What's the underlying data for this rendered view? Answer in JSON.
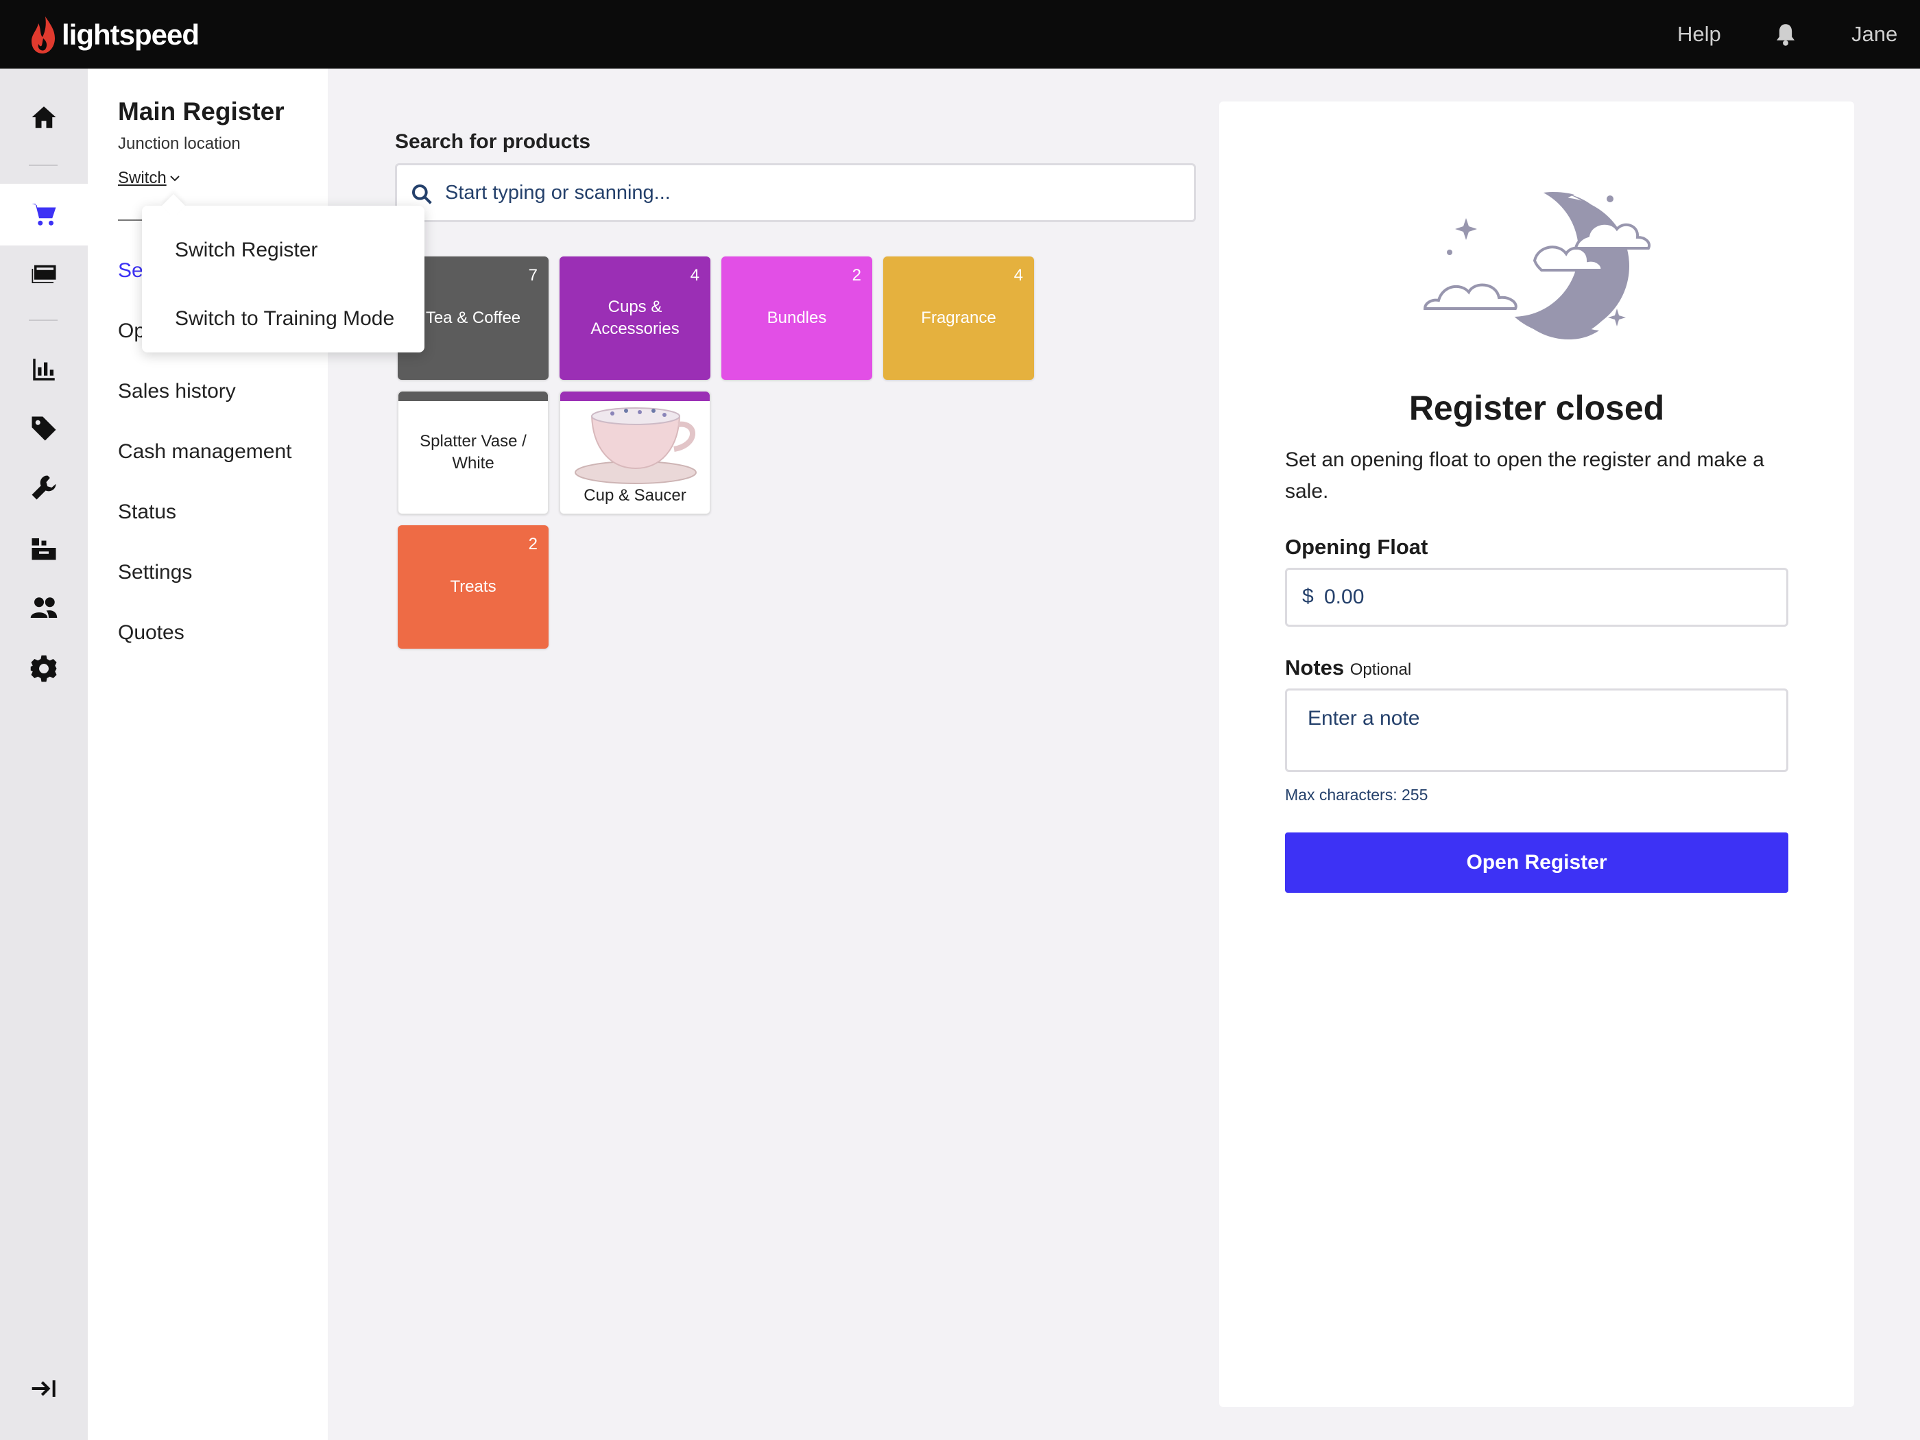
{
  "topbar": {
    "brand": "lightspeed",
    "help_label": "Help",
    "user_name": "Jane",
    "notification_icon": "bell-icon"
  },
  "rail": {
    "items": [
      {
        "icon": "home-icon"
      },
      {
        "icon": "cart-icon",
        "active": true
      },
      {
        "icon": "register-icon"
      },
      {
        "icon": "reports-icon"
      },
      {
        "icon": "tag-icon"
      },
      {
        "icon": "wrench-icon"
      },
      {
        "icon": "inventory-icon"
      },
      {
        "icon": "customers-icon"
      },
      {
        "icon": "settings-gear-icon"
      }
    ],
    "collapse_icon": "collapse-arrow-icon",
    "accent": "#3d32f5"
  },
  "subnav": {
    "register_name": "Main Register",
    "location": "Junction location",
    "switch_label": "Switch",
    "items": [
      {
        "label": "Sell",
        "active": true
      },
      {
        "label": "Open/close"
      },
      {
        "label": "Sales history"
      },
      {
        "label": "Cash management"
      },
      {
        "label": "Status"
      },
      {
        "label": "Settings"
      },
      {
        "label": "Quotes"
      }
    ]
  },
  "dropdown": {
    "items": [
      "Switch Register",
      "Switch to Training Mode"
    ]
  },
  "search": {
    "label": "Search for products",
    "placeholder": "Start typing or scanning..."
  },
  "tiles": [
    {
      "label": "Tea & Coffee",
      "count": "7",
      "color": "#5c5c5c"
    },
    {
      "label": "Cups & Accessories",
      "count": "4",
      "color": "#9b2fb5"
    },
    {
      "label": "Bundles",
      "count": "2",
      "color": "#e24fe6"
    },
    {
      "label": "Fragrance",
      "count": "4",
      "color": "#e5b13e"
    },
    {
      "label": "Splatter Vase / White",
      "band_color": "#5c5c5c"
    },
    {
      "label": "Cup & Saucer",
      "band_color": "#9b2fb5"
    },
    {
      "label": "Treats",
      "count": "2",
      "color": "#ee6b45"
    }
  ],
  "panel": {
    "title": "Register closed",
    "description": "Set an opening float to open the register and make a sale.",
    "float_label": "Opening Float",
    "currency": "$",
    "float_value": "0.00",
    "notes_label": "Notes",
    "notes_optional": "Optional",
    "notes_placeholder": "Enter a note",
    "max_chars": "Max characters: 255",
    "open_button": "Open Register"
  }
}
